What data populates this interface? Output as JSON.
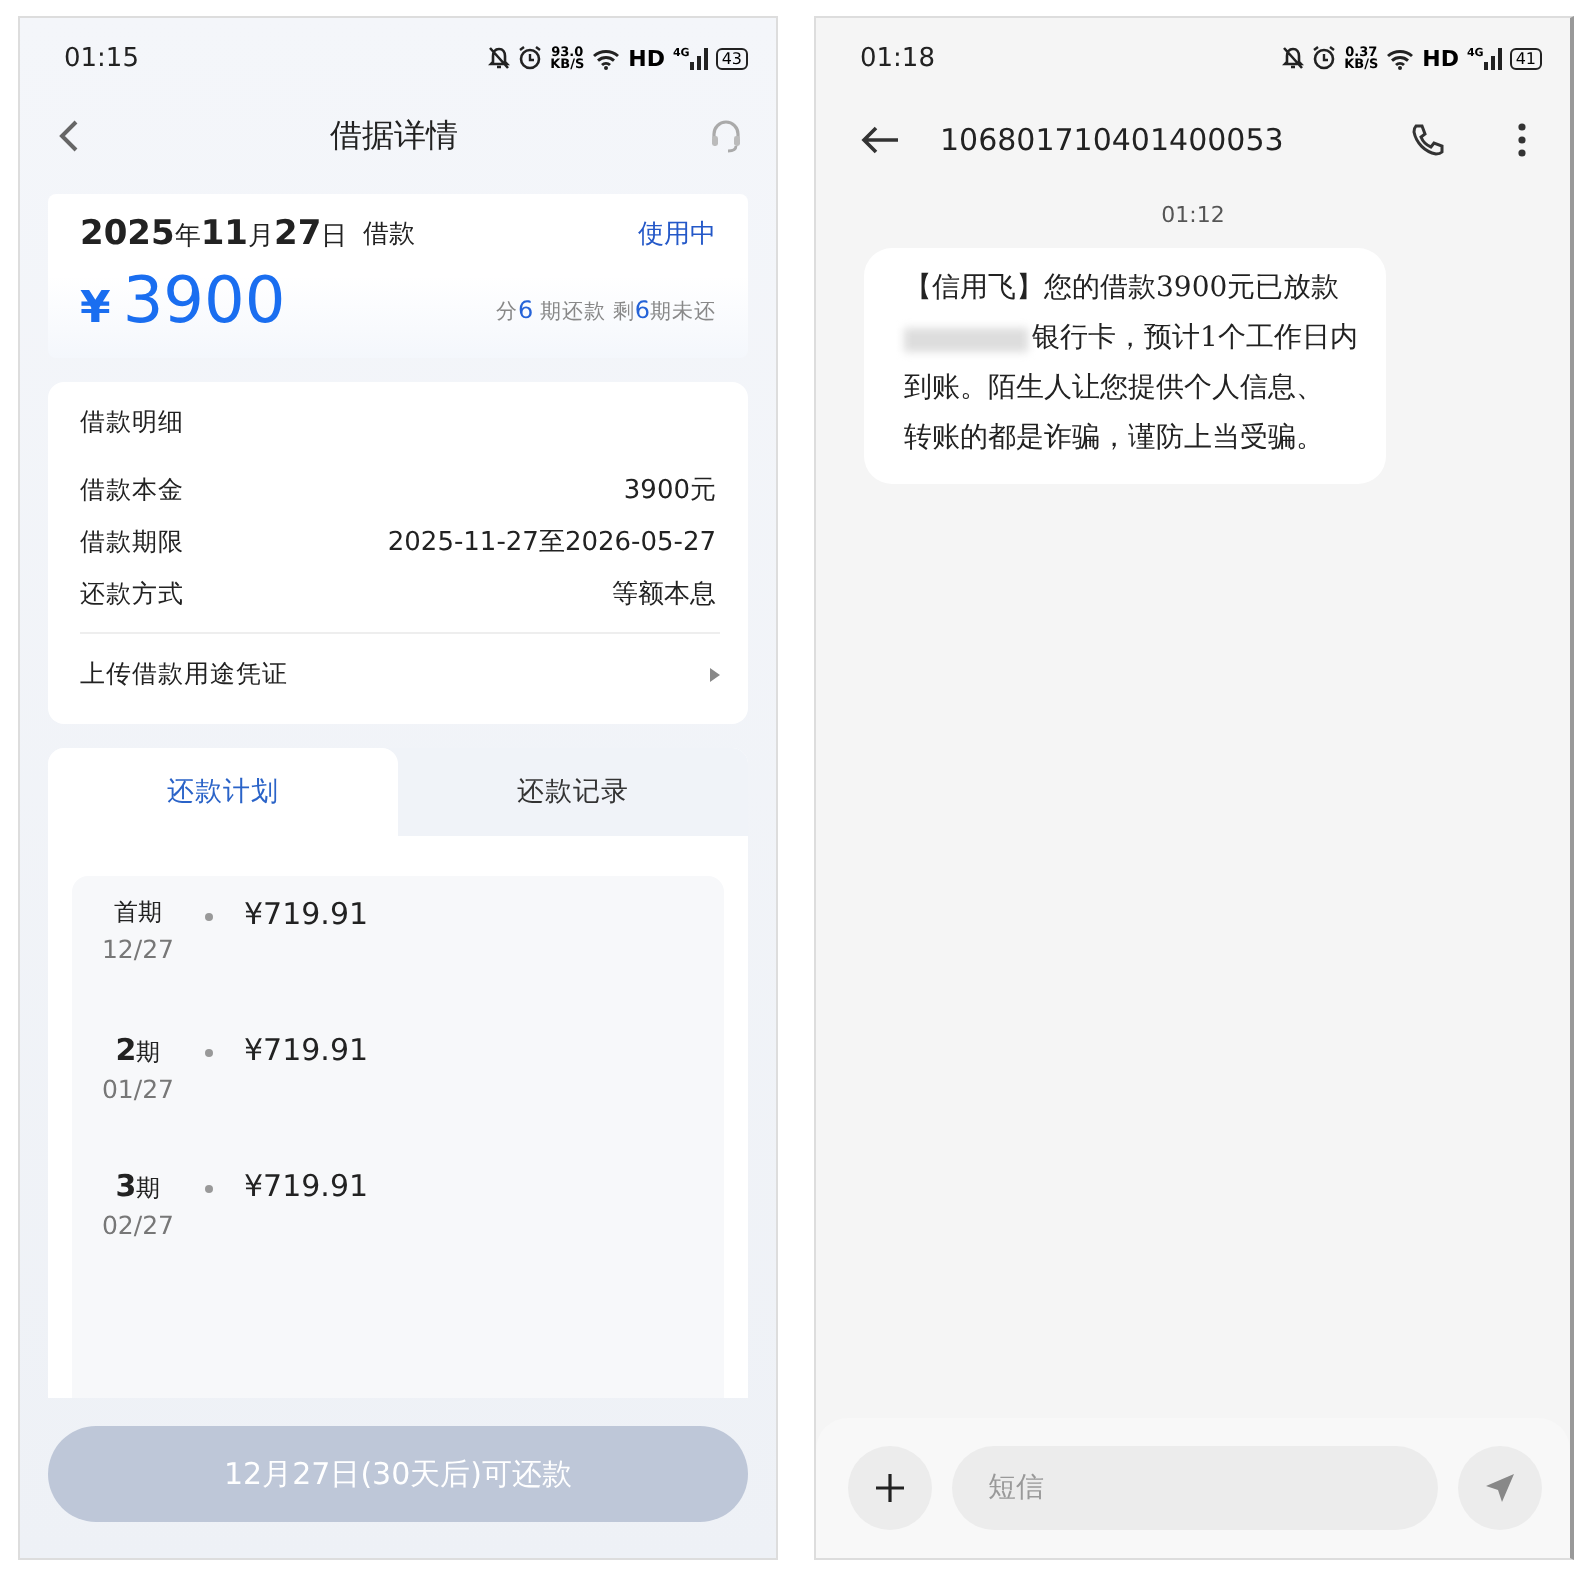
{
  "loan_screen": {
    "status_bar": {
      "time": "01:15",
      "speed": "93.0",
      "speed_unit": "KB/S",
      "network": "HD",
      "signal_label": "4G",
      "battery": "43"
    },
    "header": {
      "title": "借据详情"
    },
    "summary": {
      "date": "**2025**年**11**月**27**日",
      "label": "借款",
      "status": "使用中",
      "currency": "¥",
      "amount": "3900",
      "plan": [
        {
          "text": "分",
          "highlight": false
        },
        {
          "text": "6",
          "highlight": true
        },
        {
          "text": " 期还款 剩",
          "highlight": false
        },
        {
          "text": "6",
          "highlight": true
        },
        {
          "text": "期未还",
          "highlight": false
        }
      ]
    },
    "details": {
      "title": "借款明细",
      "rows": [
        {
          "label": "借款本金",
          "value": "3900元"
        },
        {
          "label": "借款期限",
          "value": "2025-11-27至2026-05-27"
        },
        {
          "label": "还款方式",
          "value": "等额本息"
        }
      ],
      "upload_link": "上传借款用途凭证"
    },
    "tabs": [
      {
        "label": "还款计划",
        "selected": true
      },
      {
        "label": "还款记录",
        "selected": false
      }
    ],
    "schedule": [
      {
        "period": "首期",
        "date": "12/27",
        "amount": "¥719.91"
      },
      {
        "period": "**2**期",
        "date": "01/27",
        "amount": "¥719.91"
      },
      {
        "period": "**3**期",
        "date": "02/27",
        "amount": "¥719.91"
      }
    ],
    "repay_button": {
      "label": "12月27日(30天后)可还款",
      "disabled": true
    }
  },
  "sms_screen": {
    "status_bar": {
      "time": "01:18",
      "speed": "0.37",
      "speed_unit": "KB/S",
      "network": "HD",
      "signal_label": "4G",
      "battery": "41"
    },
    "header": {
      "sender": "106801710401400053"
    },
    "timestamp": "01:12",
    "message": {
      "lines": [
        {
          "text": "【信用飞】您的借款3900元已放款",
          "redacted_prefix": false
        },
        {
          "text": "银行卡，预计1个工作日内",
          "redacted_prefix": true
        },
        {
          "text": "到账。陌生人让您提供个人信息、",
          "redacted_prefix": false
        },
        {
          "text": "转账的都是诈骗，谨防上当受骗。",
          "redacted_prefix": false
        }
      ]
    },
    "composer": {
      "placeholder": "短信"
    }
  }
}
